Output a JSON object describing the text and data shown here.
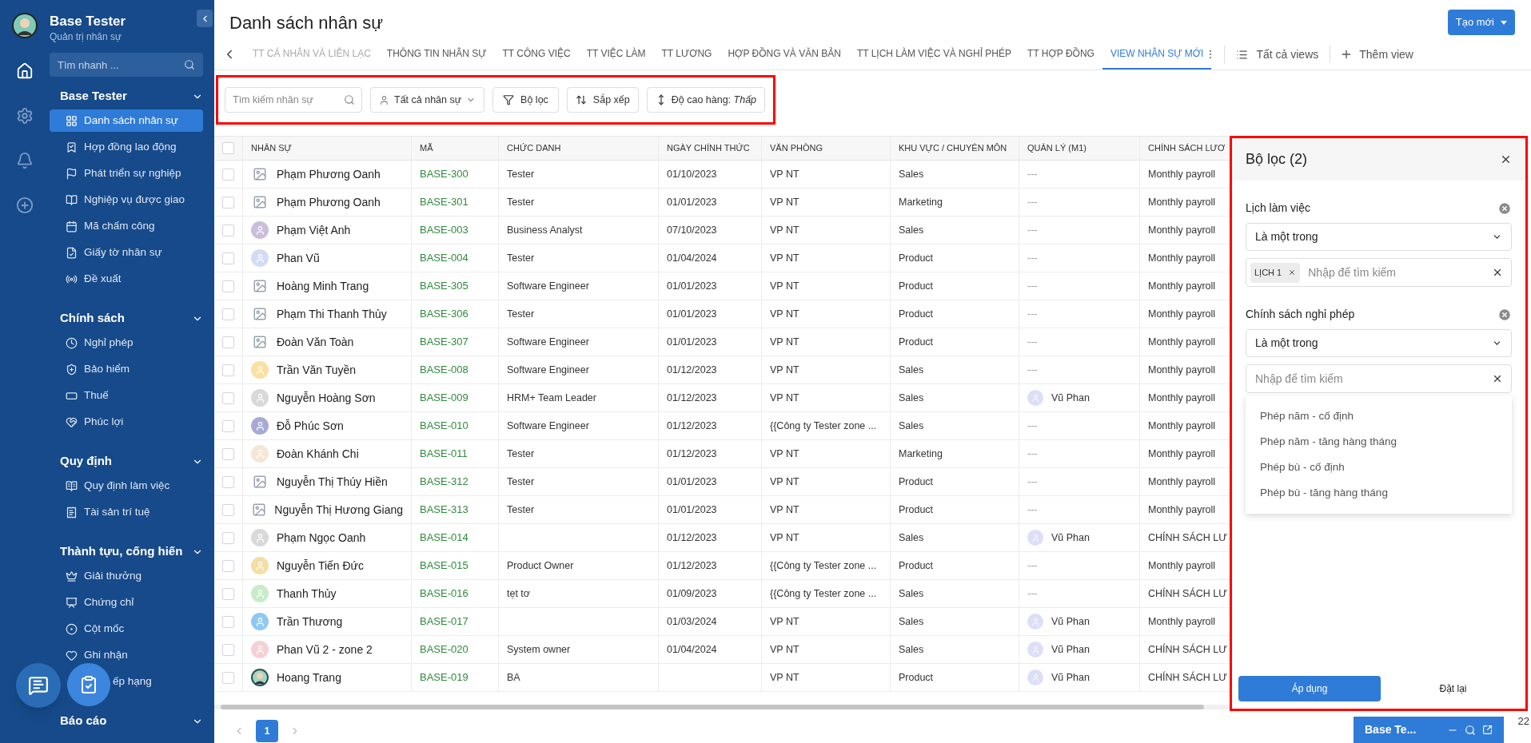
{
  "sidebar": {
    "app_title": "Base Tester",
    "app_subtitle": "Quản trị nhân sự",
    "search": {
      "placeholder": "Tìm nhanh ..."
    },
    "sections": [
      {
        "title": "Base Tester",
        "expanded": true,
        "items": [
          {
            "label": "Danh sách nhân sự",
            "selected": true
          },
          {
            "label": "Hợp đồng lao động",
            "selected": false
          },
          {
            "label": "Phát triển sự nghiệp",
            "selected": false
          },
          {
            "label": "Nghiệp vụ được giao",
            "selected": false
          },
          {
            "label": "Mã chấm công",
            "selected": false
          },
          {
            "label": "Giấy tờ nhân sự",
            "selected": false
          },
          {
            "label": "Đề xuất",
            "selected": false
          }
        ]
      },
      {
        "title": "Chính sách",
        "expanded": true,
        "items": [
          {
            "label": "Nghỉ phép",
            "selected": false
          },
          {
            "label": "Bảo hiểm",
            "selected": false
          },
          {
            "label": "Thuế",
            "selected": false
          },
          {
            "label": "Phúc lợi",
            "selected": false
          }
        ]
      },
      {
        "title": "Quy định",
        "expanded": true,
        "items": [
          {
            "label": "Quy định làm việc",
            "selected": false
          },
          {
            "label": "Tài sản trí tuệ",
            "selected": false
          }
        ]
      },
      {
        "title": "Thành tựu, cống hiến",
        "expanded": true,
        "items": [
          {
            "label": "Giải thưởng",
            "selected": false
          },
          {
            "label": "Chứng chỉ",
            "selected": false
          },
          {
            "label": "Cột mốc",
            "selected": false
          },
          {
            "label": "Ghi nhận",
            "selected": false
          },
          {
            "label": "ếp hạng",
            "selected": false
          }
        ]
      },
      {
        "title": "Báo cáo",
        "expanded": true
      }
    ]
  },
  "page_title": "Danh sách nhân sự",
  "create_button": "Tạo mới",
  "tabs": [
    {
      "label": "TT CÁ NHÂN VÀ LIÊN LẠC",
      "selected": false
    },
    {
      "label": "THÔNG TIN NHÂN SỰ",
      "selected": false
    },
    {
      "label": "TT CÔNG VIỆC",
      "selected": false
    },
    {
      "label": "TT VIỆC LÀM",
      "selected": false
    },
    {
      "label": "TT LƯƠNG",
      "selected": false
    },
    {
      "label": "HỢP ĐỒNG VÀ VĂN BẢN",
      "selected": false
    },
    {
      "label": "TT LỊCH LÀM VIỆC VÀ NGHỈ PHÉP",
      "selected": false
    },
    {
      "label": "TT HỢP ĐỒNG",
      "selected": false
    },
    {
      "label": "VIEW NHÂN SỰ MỚI",
      "selected": true
    }
  ],
  "all_views": "Tất cả views",
  "add_view": "Thêm view",
  "toolbar": {
    "search": {
      "placeholder": "Tìm kiếm nhân sự"
    },
    "scope": "Tất cả nhân sự",
    "filter": "Bộ lọc",
    "sort": "Sắp xếp",
    "row_height": "Độ cao hàng: *Thấp*"
  },
  "table": {
    "select_all": {
      "checked": false
    },
    "columns": [
      "NHÂN SỰ",
      "MÃ",
      "CHỨC DANH",
      "NGÀY CHÍNH THỨC",
      "VĂN PHÒNG",
      "KHU VỰC / CHUYÊN MÔN",
      "QUẢN LÝ (M1)",
      "CHÍNH SÁCH LƯƠ"
    ],
    "rows": [
      {
        "checked": false,
        "avatar": {
          "kind": "broken"
        },
        "name": "Phạm Phương Oanh",
        "code": "BASE-300",
        "title": "Tester",
        "date": "01/10/2023",
        "office": "VP NT",
        "area": "Sales",
        "manager": "---",
        "payroll": "Monthly payroll"
      },
      {
        "checked": false,
        "avatar": {
          "kind": "broken"
        },
        "name": "Phạm Phương Oanh",
        "code": "BASE-301",
        "title": "Tester",
        "date": "01/01/2023",
        "office": "VP NT",
        "area": "Marketing",
        "manager": "---",
        "payroll": "Monthly payroll"
      },
      {
        "checked": false,
        "avatar": {
          "kind": "silhouette",
          "color": "#c9bfdc"
        },
        "name": "Phạm Việt Anh",
        "code": "BASE-003",
        "title": "Business Analyst",
        "date": "07/10/2023",
        "office": "VP NT",
        "area": "Sales",
        "manager": "---",
        "payroll": "Monthly payroll"
      },
      {
        "checked": false,
        "avatar": {
          "kind": "silhouette",
          "color": "#d3dcf5"
        },
        "name": "Phan Vũ",
        "code": "BASE-004",
        "title": "Tester",
        "date": "01/04/2024",
        "office": "VP NT",
        "area": "Product",
        "manager": "---",
        "payroll": "Monthly payroll"
      },
      {
        "checked": false,
        "avatar": {
          "kind": "broken"
        },
        "name": "Hoàng Minh Trang",
        "code": "BASE-305",
        "title": "Software Engineer",
        "date": "01/01/2023",
        "office": "VP NT",
        "area": "Product",
        "manager": "---",
        "payroll": "Monthly payroll"
      },
      {
        "checked": false,
        "avatar": {
          "kind": "broken"
        },
        "name": "Phạm Thi Thanh Thủy",
        "code": "BASE-306",
        "title": "Tester",
        "date": "01/01/2023",
        "office": "VP NT",
        "area": "Product",
        "manager": "---",
        "payroll": "Monthly payroll"
      },
      {
        "checked": false,
        "avatar": {
          "kind": "broken"
        },
        "name": "Đoàn Văn Toàn",
        "code": "BASE-307",
        "title": "Software Engineer",
        "date": "01/01/2023",
        "office": "VP NT",
        "area": "Product",
        "manager": "---",
        "payroll": "Monthly payroll"
      },
      {
        "checked": false,
        "avatar": {
          "kind": "silhouette",
          "color": "#fbe0a0"
        },
        "name": "Trần Văn Tuyền",
        "code": "BASE-008",
        "title": "Software Engineer",
        "date": "01/12/2023",
        "office": "VP NT",
        "area": "Sales",
        "manager": "---",
        "payroll": "Monthly payroll"
      },
      {
        "checked": false,
        "avatar": {
          "kind": "silhouette",
          "color": "#d9d9d9"
        },
        "name": "Nguyễn Hoàng Sơn",
        "code": "BASE-009",
        "title": "HRM+ Team Leader",
        "date": "01/12/2023",
        "office": "VP NT",
        "area": "Sales",
        "manager": "Vũ Phan",
        "manager_avatar": true,
        "payroll": "Monthly payroll"
      },
      {
        "checked": false,
        "avatar": {
          "kind": "silhouette",
          "color": "#a9a9d6"
        },
        "name": "Đỗ Phúc Sơn",
        "code": "BASE-010",
        "title": "Software Engineer",
        "date": "01/12/2023",
        "office": "{{Công ty Tester zone ...",
        "area": "Sales",
        "manager": "---",
        "payroll": "Monthly payroll"
      },
      {
        "checked": false,
        "avatar": {
          "kind": "silhouette",
          "color": "#f5e6d6"
        },
        "name": "Đoàn Khánh Chi",
        "code": "BASE-011",
        "title": "Tester",
        "date": "01/12/2023",
        "office": "VP NT",
        "area": "Marketing",
        "manager": "---",
        "payroll": "Monthly payroll"
      },
      {
        "checked": false,
        "avatar": {
          "kind": "broken"
        },
        "name": "Nguyễn Thị Thúy Hiền",
        "code": "BASE-312",
        "title": "Tester",
        "date": "01/01/2023",
        "office": "VP NT",
        "area": "Product",
        "manager": "---",
        "payroll": "Monthly payroll"
      },
      {
        "checked": false,
        "avatar": {
          "kind": "broken"
        },
        "name": "Nguyễn Thị Hương Giang",
        "code": "BASE-313",
        "title": "Tester",
        "date": "01/01/2023",
        "office": "VP NT",
        "area": "Product",
        "manager": "---",
        "payroll": "Monthly payroll"
      },
      {
        "checked": false,
        "avatar": {
          "kind": "silhouette",
          "color": "#d9d9d9"
        },
        "name": "Phạm Ngọc Oanh",
        "code": "BASE-014",
        "date": "01/12/2023",
        "office": "VP NT",
        "area": "Sales",
        "manager": "Vũ Phan",
        "manager_avatar": true,
        "payroll": "CHÍNH SÁCH LƯ"
      },
      {
        "checked": false,
        "avatar": {
          "kind": "silhouette",
          "color": "#f3dea5"
        },
        "name": "Nguyễn Tiến Đức",
        "code": "BASE-015",
        "title": "Product Owner",
        "date": "01/12/2023",
        "office": "{{Công ty Tester zone ...",
        "area": "Product",
        "manager": "---",
        "payroll": "Monthly payroll"
      },
      {
        "checked": false,
        "avatar": {
          "kind": "silhouette",
          "color": "#c8ebc8"
        },
        "name": "Thanh Thủy",
        "code": "BASE-016",
        "title": "tẹt tơ",
        "date": "01/09/2023",
        "office": "{{Công ty Tester zone ...",
        "area": "Sales",
        "manager": "---",
        "payroll": "CHÍNH SÁCH LƯ"
      },
      {
        "checked": false,
        "avatar": {
          "kind": "silhouette",
          "color": "#90c8f5"
        },
        "name": "Trần Thương",
        "code": "BASE-017",
        "date": "01/03/2024",
        "office": "VP NT",
        "area": "Sales",
        "manager": "Vũ Phan",
        "manager_avatar": true,
        "payroll": "Monthly payroll"
      },
      {
        "checked": false,
        "avatar": {
          "kind": "silhouette",
          "color": "#f5d0d5"
        },
        "name": "Phan Vũ 2 - zone 2",
        "code": "BASE-020",
        "title": "System owner",
        "date": "01/04/2024",
        "office": "VP NT",
        "area": "Sales",
        "manager": "Vũ Phan",
        "manager_avatar": true,
        "payroll": "CHÍNH SÁCH LƯ"
      },
      {
        "checked": false,
        "avatar": {
          "kind": "photo"
        },
        "name": "Hoang Trang",
        "code": "BASE-019",
        "title": "BA",
        "office": "VP NT",
        "area": "Product",
        "manager": "Vũ Phan",
        "manager_avatar": true,
        "payroll": "CHÍNH SÁCH LƯ"
      }
    ]
  },
  "pagination": {
    "pages": [
      {
        "label": "1",
        "selected": true
      }
    ]
  },
  "total_count": "22",
  "filter_panel": {
    "title": "Bộ lọc (2)",
    "filters": [
      {
        "label": "Lịch làm việc",
        "operator": "Là một trong",
        "chips": [
          "LỊCH 1"
        ],
        "placeholder": "Nhập để tìm kiếm"
      },
      {
        "label": "Chính sách nghỉ phép",
        "operator": "Là một trong",
        "placeholder": "Nhập để tìm kiếm",
        "options": [
          "Phép năm - cố định",
          "Phép năm - tăng hàng tháng",
          "Phép bù - cố định",
          "Phép bù - tăng hàng tháng"
        ]
      }
    ],
    "apply": "Áp dụng",
    "reset": "Đặt lại"
  },
  "chat_widget": {
    "title": "Base Te..."
  }
}
